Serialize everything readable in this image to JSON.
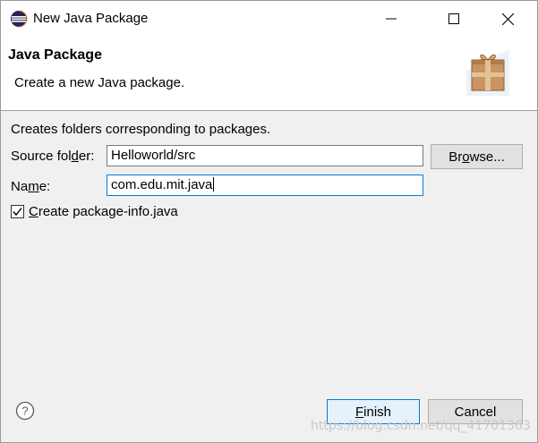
{
  "window": {
    "title": "New Java Package",
    "controls": {
      "minimize": "minimize",
      "maximize": "maximize",
      "close": "close"
    }
  },
  "banner": {
    "title": "Java Package",
    "description": "Create a new Java package."
  },
  "form": {
    "hint": "Creates folders corresponding to packages.",
    "source_folder_label_pre": "Source fol",
    "source_folder_label_mnemonic": "d",
    "source_folder_label_post": "er:",
    "source_folder_value": "Helloworld/src",
    "browse_label_pre": "Br",
    "browse_label_mnemonic": "o",
    "browse_label_post": "wse...",
    "name_label_pre": "Na",
    "name_label_mnemonic": "m",
    "name_label_post": "e:",
    "name_value": "com.edu.mit.java",
    "checkbox_mnemonic": "C",
    "checkbox_label_rest": "reate package-info.java",
    "checkbox_checked": true
  },
  "footer": {
    "finish_mnemonic": "F",
    "finish_rest": "inish",
    "cancel_label": "Cancel"
  },
  "watermark": "https://blog.csdn.net/qq_41701363",
  "colors": {
    "accent": "#0078d7",
    "button_bg": "#e1e1e1",
    "dialog_bg": "#f0f0f0"
  },
  "icons": {
    "app": "eclipse-icon",
    "wizard": "package-box-icon",
    "help": "help-icon"
  }
}
